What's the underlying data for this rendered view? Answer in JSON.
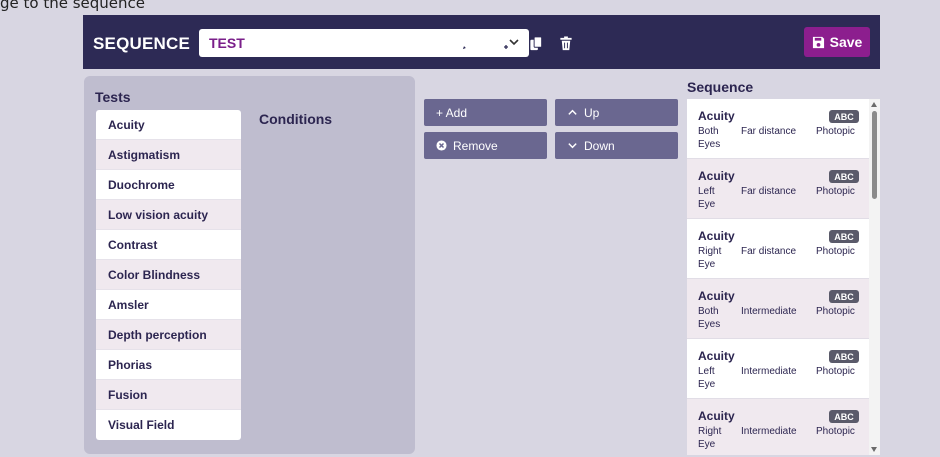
{
  "caption": "ge to the sequence",
  "header": {
    "title": "SEQUENCE",
    "selected_sequence": "TEST",
    "save_label": "Save"
  },
  "tests_panel": {
    "title": "Tests",
    "conditions_title": "Conditions",
    "tests": [
      "Acuity",
      "Astigmatism",
      "Duochrome",
      "Low vision acuity",
      "Contrast",
      "Color Blindness",
      "Amsler",
      "Depth perception",
      "Phorias",
      "Fusion",
      "Visual Field"
    ]
  },
  "actions": {
    "add": "+ Add",
    "remove": "Remove",
    "up": "Up",
    "down": "Down"
  },
  "sequence": {
    "title": "Sequence",
    "items": [
      {
        "name": "Acuity",
        "badge": "ABC",
        "eye": "Both Eyes",
        "distance": "Far distance",
        "lighting": "Photopic"
      },
      {
        "name": "Acuity",
        "badge": "ABC",
        "eye": "Left Eye",
        "distance": "Far distance",
        "lighting": "Photopic"
      },
      {
        "name": "Acuity",
        "badge": "ABC",
        "eye": "Right Eye",
        "distance": "Far distance",
        "lighting": "Photopic"
      },
      {
        "name": "Acuity",
        "badge": "ABC",
        "eye": "Both Eyes",
        "distance": "Intermediate",
        "lighting": "Photopic"
      },
      {
        "name": "Acuity",
        "badge": "ABC",
        "eye": "Left Eye",
        "distance": "Intermediate",
        "lighting": "Photopic"
      },
      {
        "name": "Acuity",
        "badge": "ABC",
        "eye": "Right Eye",
        "distance": "Intermediate",
        "lighting": "Photopic"
      }
    ]
  },
  "colors": {
    "header_bg": "#2d2a55",
    "accent": "#8c1e8e",
    "button_bg": "#6a6790",
    "badge_bg": "#5a5a6a"
  },
  "icons": [
    "chevron-down-icon",
    "pencil-icon",
    "new-file-icon",
    "copy-icon",
    "trash-icon",
    "floppy-disk-icon",
    "remove-circle-icon",
    "chevron-up-icon"
  ]
}
